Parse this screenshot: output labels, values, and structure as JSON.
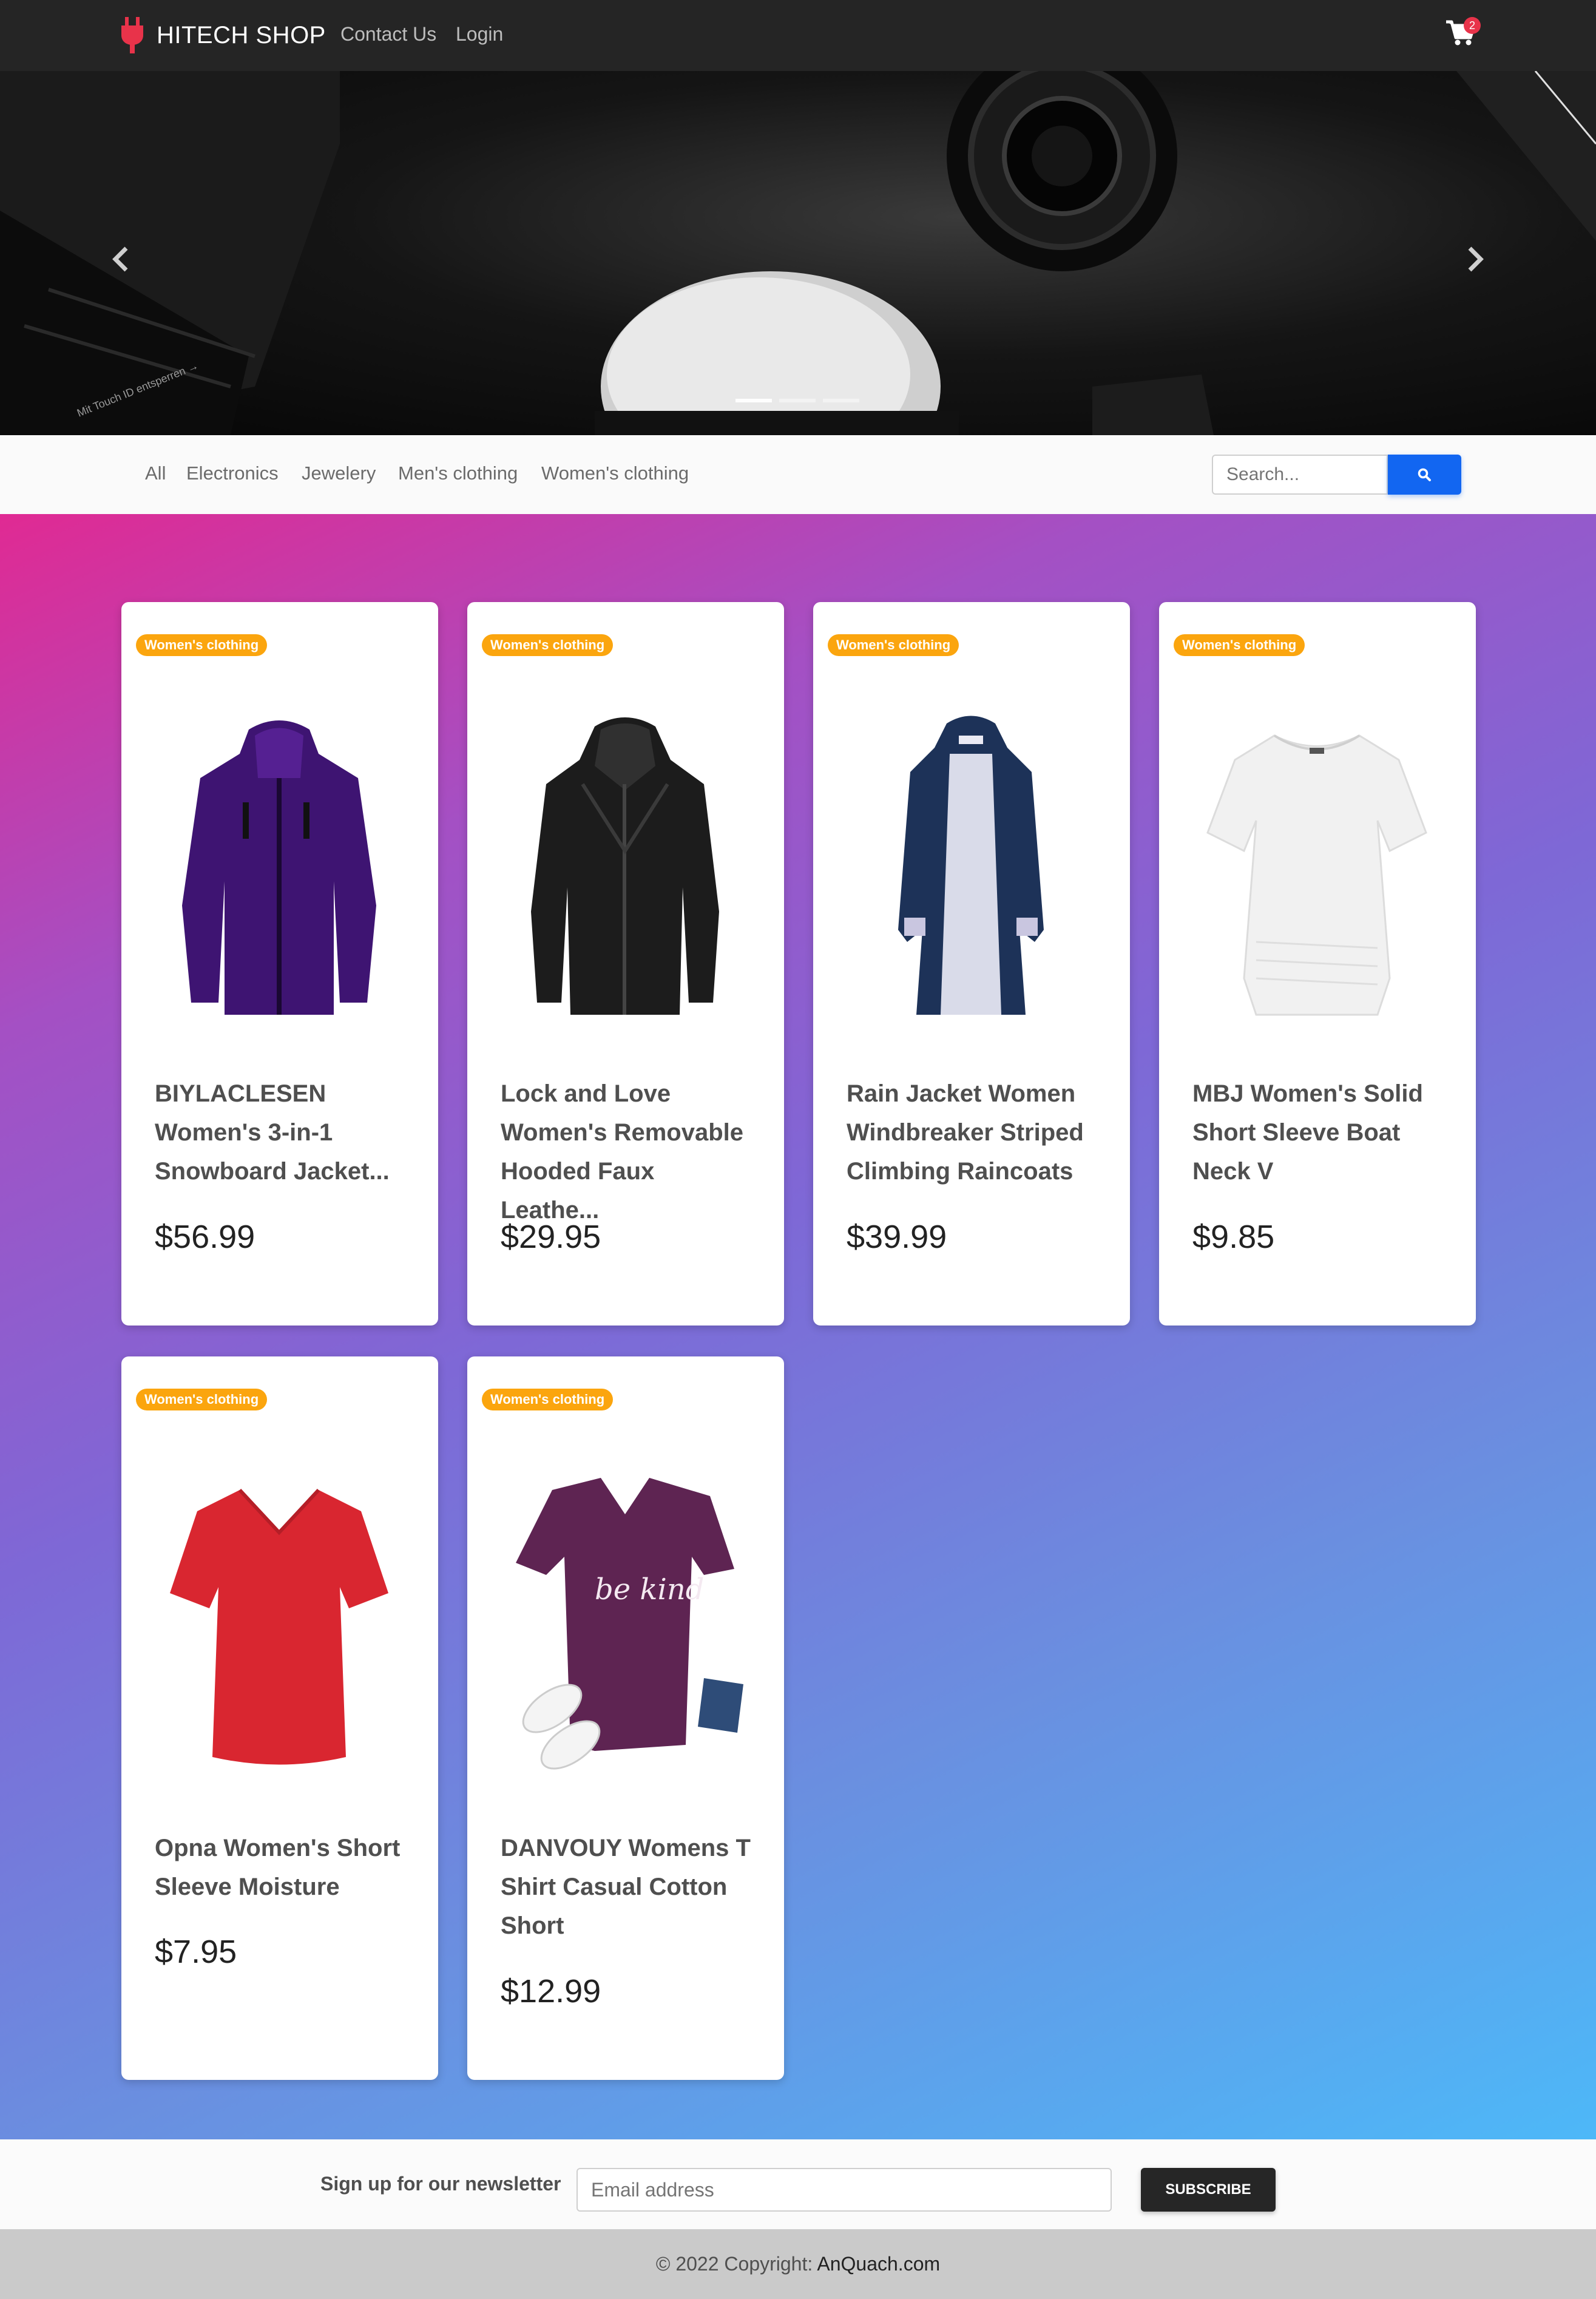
{
  "navbar": {
    "brand": "HITECH SHOP",
    "links": [
      "Contact Us",
      "Login"
    ],
    "cart_count": "2"
  },
  "categories": [
    "All",
    "Electronics",
    "Jewelery",
    "Men's clothing",
    "Women's clothing"
  ],
  "search": {
    "placeholder": "Search..."
  },
  "products": [
    {
      "category": "Women's clothing",
      "title": "BIYLACLESEN Women's 3-in-1 Snowboard Jacket...",
      "price": "$56.99",
      "color": "#3e1472"
    },
    {
      "category": "Women's clothing",
      "title": "Lock and Love Women's Removable Hooded Faux Leathe...",
      "price": "$29.95",
      "color": "#1c1c1c"
    },
    {
      "category": "Women's clothing",
      "title": "Rain Jacket Women Windbreaker Striped Climbing Raincoats",
      "price": "$39.99",
      "color": "#1d3258"
    },
    {
      "category": "Women's clothing",
      "title": "MBJ Women's Solid Short Sleeve Boat Neck V",
      "price": "$9.85",
      "color": "#f1f1f1"
    },
    {
      "category": "Women's clothing",
      "title": "Opna Women's Short Sleeve Moisture",
      "price": "$7.95",
      "color": "#d92630"
    },
    {
      "category": "Women's clothing",
      "title": "DANVOUY Womens T Shirt Casual Cotton Short",
      "price": "$12.99",
      "color": "#5e2452",
      "print": "be kind"
    }
  ],
  "newsletter": {
    "label": "Sign up for our newsletter",
    "placeholder": "Email address",
    "button": "SUBSCRIBE"
  },
  "footer": {
    "text": "© 2022 Copyright:",
    "site": "AnQuach.com"
  },
  "colors": {
    "accent": "#1266f1",
    "badge": "#fba50e",
    "navbar": "#252525",
    "cart_badge": "#e8334a"
  }
}
